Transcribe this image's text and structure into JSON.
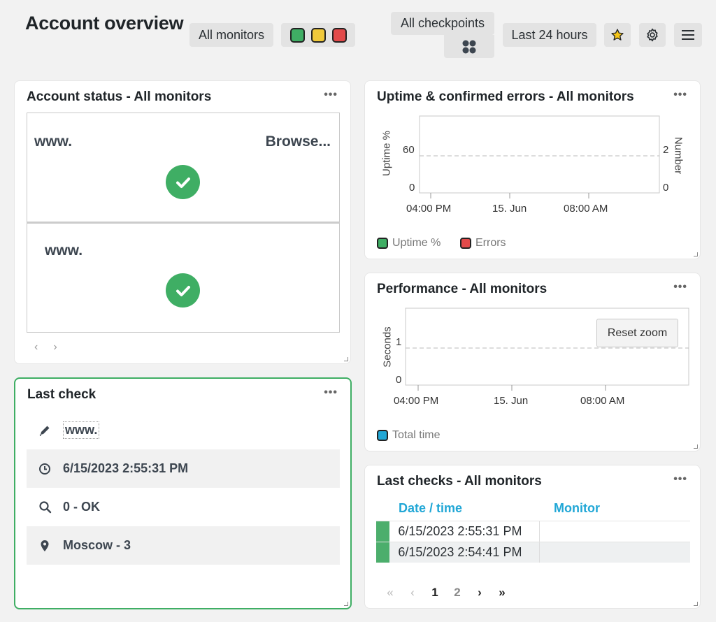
{
  "header": {
    "title": "Account overview",
    "monitors_filter": "All monitors",
    "status_colors": [
      "#3fae64",
      "#f0c93a",
      "#e24a4a"
    ],
    "checkpoints_filter": "All checkpoints",
    "period": "Last 24 hours"
  },
  "account_status": {
    "title": "Account status - All monitors",
    "tiles": [
      {
        "left_label": "www.",
        "right_label": "Browse..."
      },
      {
        "left_label": "www."
      }
    ],
    "prev": "‹",
    "next": "›"
  },
  "uptime": {
    "title": "Uptime & confirmed errors - All monitors",
    "y_left_title": "Uptime %",
    "y_right_title": "Number",
    "y_left_ticks": [
      "60",
      "0"
    ],
    "y_right_ticks": [
      "2",
      "0"
    ],
    "x_ticks": [
      "04:00 PM",
      "15. Jun",
      "08:00 AM"
    ],
    "legend": [
      {
        "label": "Uptime %",
        "color": "#3fae64"
      },
      {
        "label": "Errors",
        "color": "#e24a4a"
      }
    ]
  },
  "performance": {
    "title": "Performance - All monitors",
    "y_title": "Seconds",
    "y_ticks": [
      "1",
      "0"
    ],
    "x_ticks": [
      "04:00 PM",
      "15. Jun",
      "08:00 AM"
    ],
    "reset_zoom": "Reset zoom",
    "legend": [
      {
        "label": "Total time",
        "color": "#21a7d6"
      }
    ]
  },
  "last_check": {
    "title": "Last check",
    "monitor": "www.",
    "datetime": "6/15/2023 2:55:31 PM",
    "result": "0 - OK",
    "location": "Moscow - 3"
  },
  "last_checks": {
    "title": "Last checks - All monitors",
    "columns": [
      "Date / time",
      "Monitor"
    ],
    "rows": [
      {
        "datetime": "6/15/2023 2:55:31 PM",
        "monitor": ""
      },
      {
        "datetime": "6/15/2023 2:54:41 PM",
        "monitor": ""
      }
    ],
    "pager": {
      "first": "«",
      "prev": "‹",
      "pages": [
        "1",
        "2"
      ],
      "next": "›",
      "last": "»"
    }
  },
  "card_menu": "•••"
}
